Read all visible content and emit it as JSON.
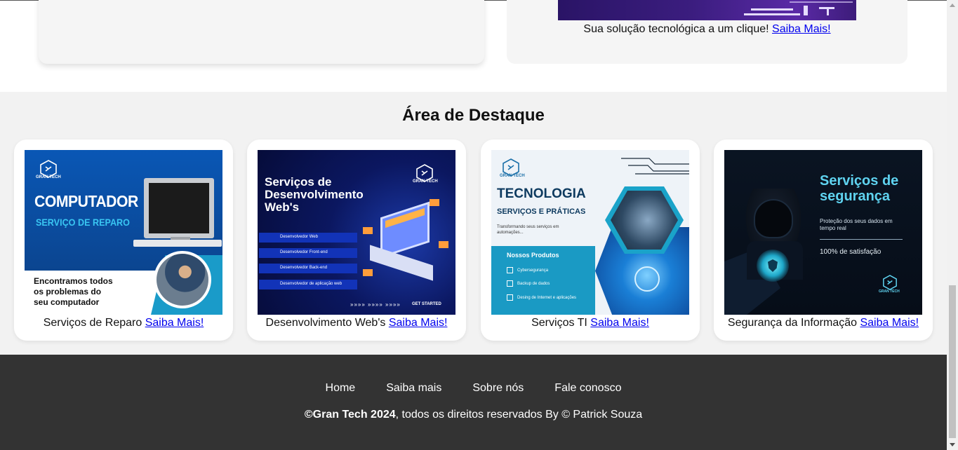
{
  "previous_section": {
    "right_card_text": "Sua solução tecnológica a um clique!",
    "right_card_link": "Saiba Mais!"
  },
  "highlight": {
    "title": "Área de Destaque",
    "cards": [
      {
        "caption": "Serviços de Reparo",
        "link": "Saiba Mais!",
        "image": {
          "brand": "GRAN TECH",
          "heading": "COMPUTADOR",
          "subheading": "SERVIÇO DE REPARO",
          "tagline_1": "Encontramos todos",
          "tagline_2": "os problemas do",
          "tagline_3": "seu computador"
        }
      },
      {
        "caption": "Desenvolvimento Web's",
        "link": "Saiba Mais!",
        "image": {
          "brand": "GRAN TECH",
          "heading_1": "Serviços de",
          "heading_2": "Desenvolvimento",
          "heading_3": "Web's",
          "items": [
            "Desenvolvedor Web",
            "Desenvolvedor Front-end",
            "Desenvolvedor Back-end",
            "Desenvolvedor de aplicação web"
          ],
          "arrows": "»»»» »»»» »»»»",
          "cta": "GET STARTED"
        }
      },
      {
        "caption": "Serviços TI",
        "link": "Saiba Mais!",
        "image": {
          "brand": "GRAN TECH",
          "heading": "TECNOLOGIA",
          "subheading": "SERVIÇOS E PRÁTICAS",
          "intro_1": "Transformando seus serviços em",
          "intro_2": "automações...",
          "products_title": "Nossos Produtos",
          "products": [
            "Cybersegurança",
            "Backup de dados",
            "Desing de Internet e aplicações"
          ]
        }
      },
      {
        "caption": "Segurança da Informação",
        "link": "Saiba Mais!",
        "image": {
          "brand": "GRAN TECH",
          "heading_1": "Serviços de",
          "heading_2": "segurança",
          "desc_1": "Proteção dos seus dados em",
          "desc_2": "tempo real",
          "satisfaction": "100% de satisfação"
        }
      }
    ]
  },
  "footer": {
    "nav": [
      "Home",
      "Saiba mais",
      "Sobre nós",
      "Fale conosco"
    ],
    "copyright_bold": "©Gran Tech 2024",
    "copyright_rest": ", todos os direitos reservados By © Patrick Souza"
  }
}
